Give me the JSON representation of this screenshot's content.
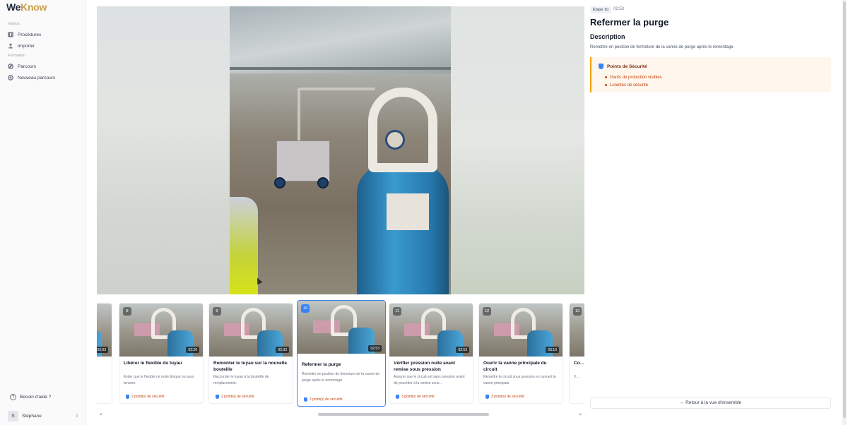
{
  "brand": {
    "we": "We",
    "know": "Know"
  },
  "sidebar": {
    "section_videos": "Vidéos",
    "items_videos": [
      {
        "label": "Procédures",
        "icon": "film-icon"
      },
      {
        "label": "Importer",
        "icon": "upload-icon"
      }
    ],
    "section_training": "Formation",
    "items_training": [
      {
        "label": "Parcours",
        "icon": "compass-icon"
      },
      {
        "label": "Nouveau parcours",
        "icon": "plus-circle-icon"
      }
    ],
    "help": "Besoin d'aide ?",
    "user": {
      "initial": "S",
      "name": "Stéphane"
    }
  },
  "step": {
    "badge": "Étape 10",
    "duration": "02:53",
    "title": "Refermer la purge",
    "description_heading": "Description",
    "description": "Remettre en position de fermeture de la vanne de purge après le remontage.",
    "safety_heading": "Points de Sécurité",
    "safety_items": [
      "Gants de protection visibles",
      "Lunettes de sécurité"
    ]
  },
  "back_button": "← Retour à la vue d'ensemble",
  "steps": [
    {
      "num": "",
      "title": "",
      "desc": "",
      "duration": "02:03",
      "safety": ""
    },
    {
      "num": "8",
      "title": "Libérer le flexible du tuyau",
      "desc": "Éviter que le flexible ne reste bloqué ou sous tension.",
      "duration": "02:26",
      "safety": "2 point(s) de sécurité"
    },
    {
      "num": "9",
      "title": "Remonter le tuyau sur la nouvelle bouteille",
      "desc": "Raccorder le tuyau à la bouteille de remplacement.",
      "duration": "02:33",
      "safety": "2 point(s) de sécurité"
    },
    {
      "num": "10",
      "title": "Refermer la purge",
      "desc": "Remettre en position de fermeture de la vanne de purge après le remontage.",
      "duration": "02:53",
      "safety": "2 point(s) de sécurité"
    },
    {
      "num": "11",
      "title": "Vérifier pression nulle avant remise sous pression",
      "desc": "Assurer que le circuit est sans pression avant de procéder à la remise sous…",
      "duration": "02:53",
      "safety": "3 point(s) de sécurité"
    },
    {
      "num": "12",
      "title": "Ouvrir la vanne principale du circuit",
      "desc": "Remettre le circuit sous pression en ouvrant la vanne principale.",
      "duration": "03:10",
      "safety": "3 point(s) de sécurité"
    },
    {
      "num": "13",
      "title": "Co…",
      "desc": "V…",
      "duration": "",
      "safety": ""
    }
  ]
}
